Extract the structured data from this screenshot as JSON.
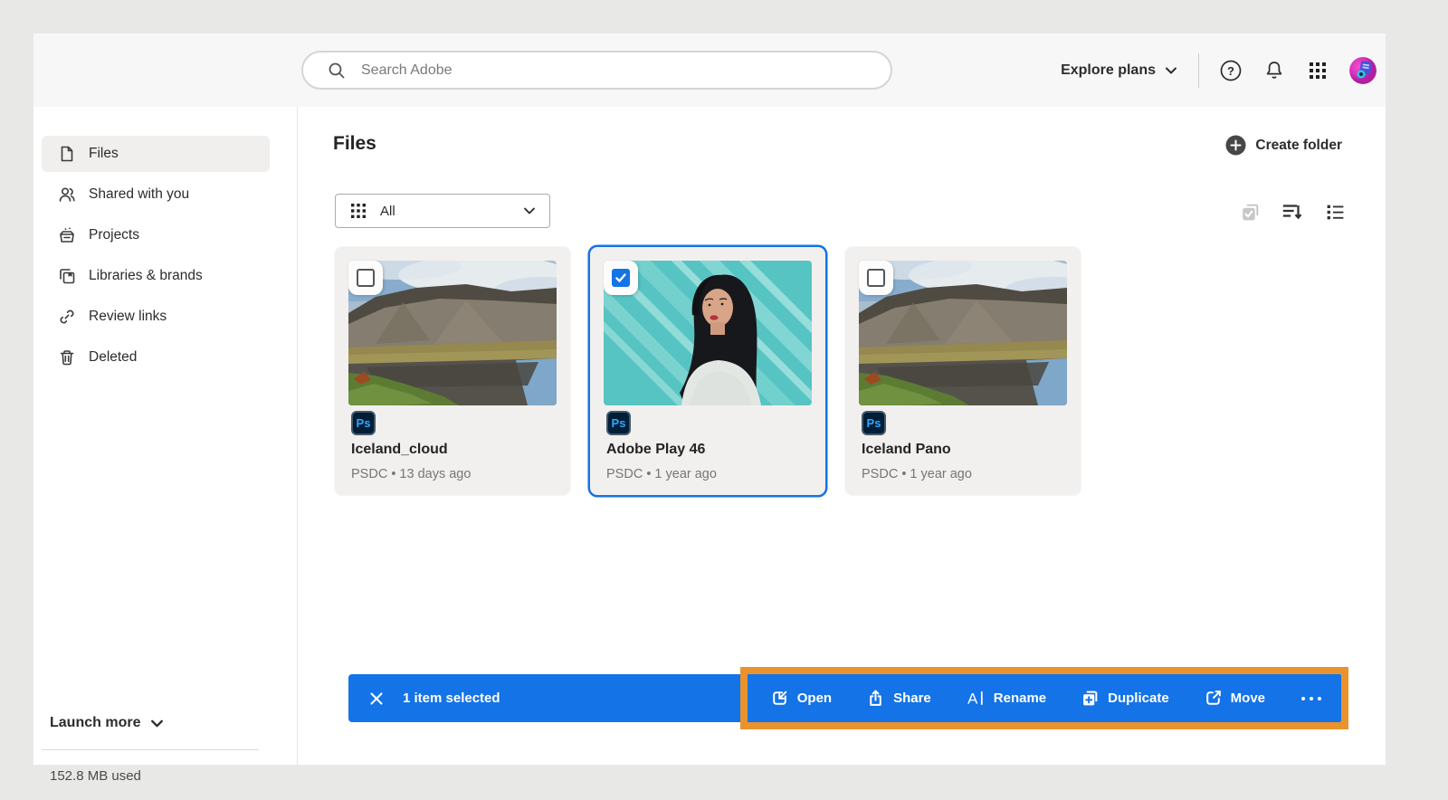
{
  "header": {
    "search": {
      "placeholder": "Search Adobe",
      "icon": "search-icon"
    },
    "explore_plans_label": "Explore plans",
    "icons": [
      "help-icon",
      "notifications-icon",
      "app-switcher-icon",
      "avatar"
    ]
  },
  "sidebar": {
    "items": [
      {
        "label": "Files",
        "icon": "file-icon",
        "active": true
      },
      {
        "label": "Shared with you",
        "icon": "people-icon",
        "active": false
      },
      {
        "label": "Projects",
        "icon": "projects-icon",
        "active": false
      },
      {
        "label": "Libraries & brands",
        "icon": "libraries-icon",
        "active": false
      },
      {
        "label": "Review links",
        "icon": "link-icon",
        "active": false
      },
      {
        "label": "Deleted",
        "icon": "trash-icon",
        "active": false
      }
    ],
    "launch_more_label": "Launch more",
    "storage_used": "152.8 MB used"
  },
  "main": {
    "title": "Files",
    "create_folder_label": "Create folder",
    "filter": {
      "selected": "All",
      "icon": "grid-icon"
    },
    "toolbar_icons": [
      "select-all-icon",
      "sort-icon",
      "list-view-icon"
    ],
    "cards": [
      {
        "title": "Iceland_cloud",
        "meta": "PSDC • 13 days ago",
        "badge": "Ps",
        "selected": false,
        "checked": false
      },
      {
        "title": "Adobe Play 46",
        "meta": "PSDC • 1 year ago",
        "badge": "Ps",
        "selected": true,
        "checked": true
      },
      {
        "title": "Iceland Pano",
        "meta": "PSDC • 1 year ago",
        "badge": "Ps",
        "selected": false,
        "checked": false
      }
    ]
  },
  "selection_bar": {
    "status": "1 item selected",
    "actions": [
      {
        "label": "Open",
        "icon": "open-icon"
      },
      {
        "label": "Share",
        "icon": "share-icon"
      },
      {
        "label": "Rename",
        "icon": "rename-icon"
      },
      {
        "label": "Duplicate",
        "icon": "duplicate-icon"
      },
      {
        "label": "Move",
        "icon": "move-icon"
      }
    ]
  },
  "annotation": {
    "type": "highlight-box",
    "color": "#E8932E"
  },
  "colors": {
    "accent_blue": "#1473E6",
    "highlight_orange": "#E8932E",
    "ps_badge_bg": "#001E36",
    "ps_badge_text": "#31A8FF",
    "topbar_bg": "#F7F7F7",
    "card_bg": "#F1F0EF"
  }
}
